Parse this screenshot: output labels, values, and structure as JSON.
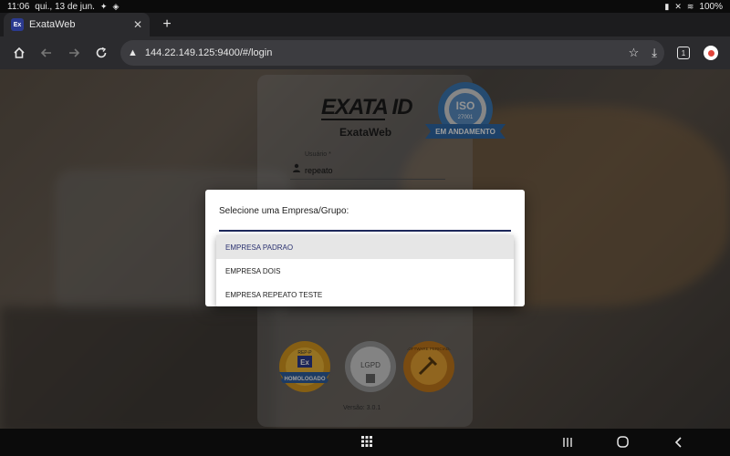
{
  "status_bar": {
    "time": "11:06",
    "date": "qui., 13 de jun.",
    "battery": "100%"
  },
  "tab": {
    "favicon_text": "Ex",
    "title": "ExataWeb",
    "close": "✕"
  },
  "new_tab": "+",
  "toolbar": {
    "url": "144.22.149.125:9400/#/login",
    "tab_count": "1"
  },
  "login": {
    "logo": "EXATA ID",
    "app_name": "ExataWeb",
    "iso_badge": {
      "top_text": "ISO",
      "number": "27001",
      "ribbon": "EM ANDAMENTO"
    },
    "usuario_label": "Usuário *",
    "usuario_value": "repeato",
    "seals": {
      "rep": {
        "top": "REP-P",
        "mid": "Ex",
        "ribbon": "HOMOLOGADO"
      },
      "lgpd": {
        "main": "LGPD"
      },
      "software": {
        "text": "SOFTWARE PERICIADO"
      }
    },
    "version": "Versão: 3.0.1"
  },
  "modal": {
    "title": "Selecione uma Empresa/Grupo:",
    "options": [
      "EMPRESA PADRAO",
      "EMPRESA DOIS",
      "EMPRESA REPEATO TESTE"
    ]
  },
  "colors": {
    "select_underline": "#1f2a5c",
    "selected_option_bg": "#e6e6e6"
  }
}
